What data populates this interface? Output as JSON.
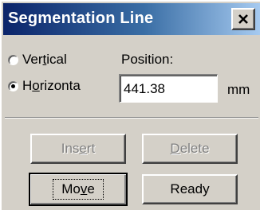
{
  "window": {
    "title": "Segmentation Line",
    "close_icon": "close-icon"
  },
  "orientation": {
    "vertical": {
      "label_before": "Ver",
      "label_mnemonic": "t",
      "label_after": "ical",
      "checked": false
    },
    "horizontal": {
      "label_before": "H",
      "label_mnemonic": "o",
      "label_after": "rizonta",
      "checked": true
    }
  },
  "position": {
    "label": "Position:",
    "value": "441.38",
    "unit": "mm"
  },
  "buttons": {
    "insert": {
      "before": "Ins",
      "mnemonic": "e",
      "after": "rt",
      "enabled": false
    },
    "delete": {
      "before": "",
      "mnemonic": "D",
      "after": "elete",
      "enabled": false
    },
    "move": {
      "before": "Mo",
      "mnemonic": "v",
      "after": "e",
      "enabled": true,
      "default": true
    },
    "ready": {
      "before": "Ready",
      "mnemonic": "",
      "after": "",
      "enabled": true
    }
  },
  "colors": {
    "face": "#d4d0c8",
    "title_start": "#0b246a",
    "title_end": "#a6caf0",
    "disabled_text": "#808080"
  }
}
